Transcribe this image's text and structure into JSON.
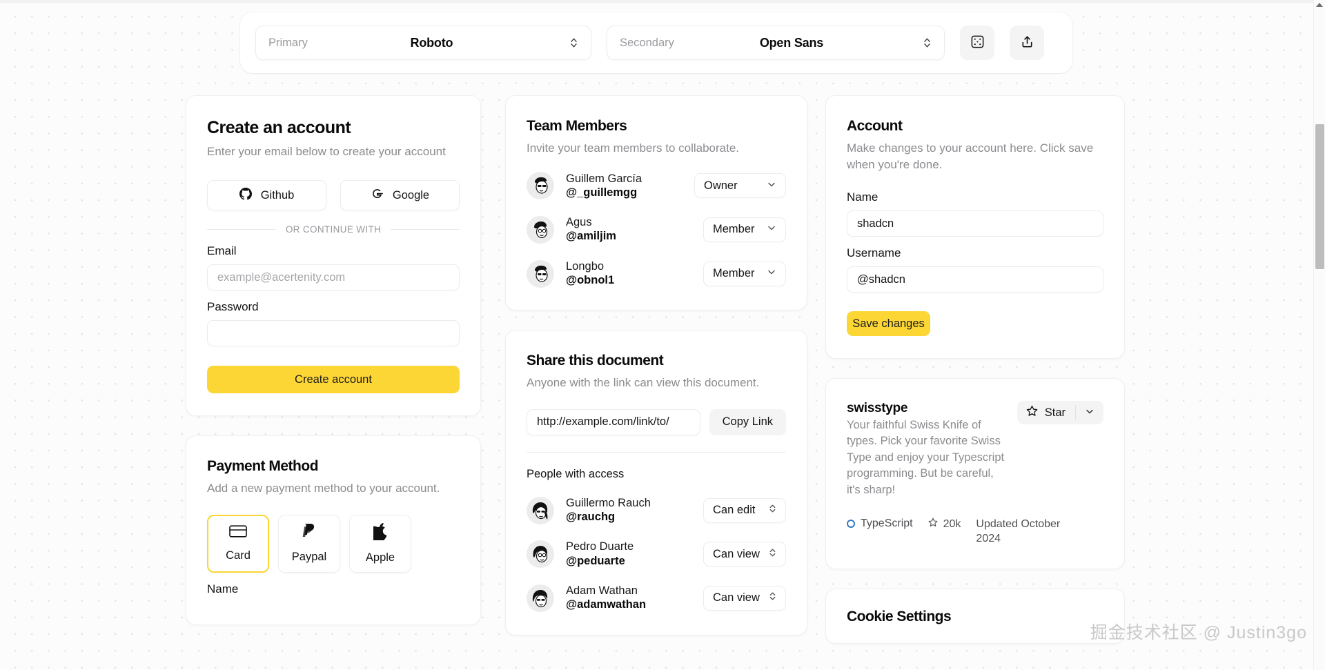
{
  "toolbar": {
    "primary": {
      "label": "Primary",
      "value": "Roboto"
    },
    "secondary": {
      "label": "Secondary",
      "value": "Open Sans"
    },
    "randomize_icon": "dice-icon",
    "share_icon": "share-upload-icon"
  },
  "create_account": {
    "title": "Create an account",
    "description": "Enter your email below to create your account",
    "github_label": "Github",
    "google_label": "Google",
    "divider": "OR CONTINUE WITH",
    "email_label": "Email",
    "email_placeholder": "example@acertenity.com",
    "email_value": "",
    "password_label": "Password",
    "password_value": "",
    "submit_label": "Create account"
  },
  "payment": {
    "title": "Payment Method",
    "description": "Add a new payment method to your account.",
    "methods": [
      {
        "label": "Card",
        "icon": "credit-card-icon",
        "selected": true
      },
      {
        "label": "Paypal",
        "icon": "paypal-icon",
        "selected": false
      },
      {
        "label": "Apple",
        "icon": "apple-icon",
        "selected": false
      }
    ],
    "name_label": "Name"
  },
  "team": {
    "title": "Team Members",
    "description": "Invite your team members to collaborate.",
    "members": [
      {
        "name": "Guillem García",
        "handle": "@_guillemgg",
        "role": "Owner"
      },
      {
        "name": "Agus",
        "handle": "@amiljim",
        "role": "Member"
      },
      {
        "name": "Longbo",
        "handle": "@obnol1",
        "role": "Member"
      }
    ]
  },
  "share": {
    "title": "Share this document",
    "description": "Anyone with the link can view this document.",
    "link_value": "http://example.com/link/to/",
    "copy_label": "Copy Link",
    "people_label": "People with access",
    "people": [
      {
        "name": "Guillermo Rauch",
        "handle": "@rauchg",
        "permission": "Can edit"
      },
      {
        "name": "Pedro Duarte",
        "handle": "@peduarte",
        "permission": "Can view"
      },
      {
        "name": "Adam Wathan",
        "handle": "@adamwathan",
        "permission": "Can view"
      }
    ]
  },
  "account": {
    "title": "Account",
    "description": "Make changes to your account here. Click save when you're done.",
    "name_label": "Name",
    "name_value": "shadcn",
    "username_label": "Username",
    "username_value": "@shadcn",
    "save_label": "Save changes"
  },
  "swisstype": {
    "title": "swisstype",
    "description": "Your faithful Swiss Knife of types. Pick your favorite Swiss Type and enjoy your Typescript programming. But be careful, it's sharp!",
    "star_label": "Star",
    "language": "TypeScript",
    "language_color": "#3178c6",
    "stars": "20k",
    "updated": "Updated October 2024"
  },
  "cookie": {
    "title": "Cookie Settings"
  },
  "watermark": "掘金技术社区 @ Justin3go",
  "accent_color": "#fcd635"
}
